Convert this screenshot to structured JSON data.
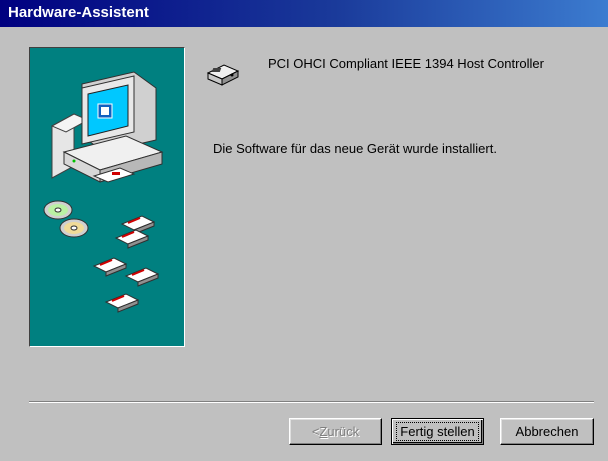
{
  "window": {
    "title": "Hardware-Assistent"
  },
  "device": {
    "icon": "pci-card-icon",
    "name": "PCI OHCI Compliant IEEE 1394 Host Controller"
  },
  "message": "Die Software für das neue Gerät wurde installiert.",
  "buttons": {
    "back_prefix": "< ",
    "back_hotkey": "Z",
    "back_rest": "urück",
    "finish": "Fertig stellen",
    "cancel": "Abbrechen"
  },
  "colors": {
    "panel_bg": "#008080",
    "titlebar_start": "#000080",
    "face": "#c0c0c0"
  }
}
